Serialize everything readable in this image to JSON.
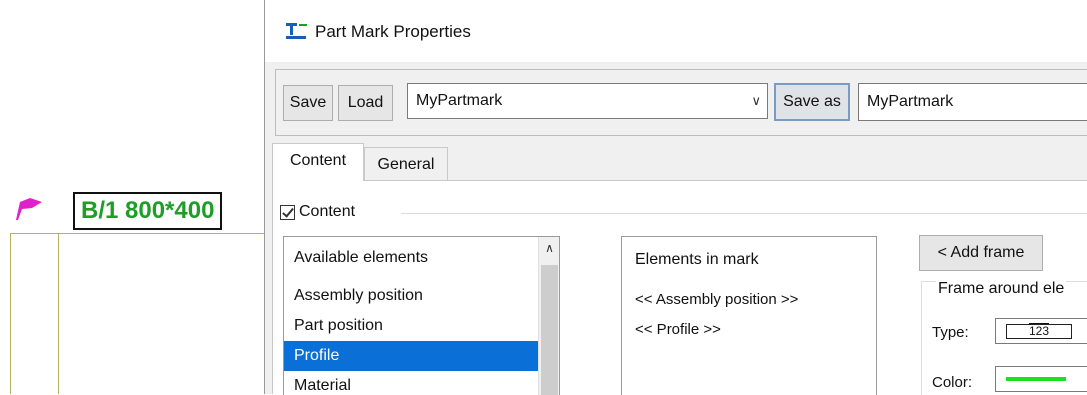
{
  "drawing": {
    "partmark_text": "B/1 800*400",
    "colors": {
      "partmark_text": "#1e9e27",
      "leader_flag": "#e020c8",
      "gridline": "#b3b15a"
    }
  },
  "dialog": {
    "title": "Part Mark Properties",
    "toolbar": {
      "save_label": "Save",
      "load_label": "Load",
      "settings_value": "MyPartmark",
      "save_as_label": "Save as",
      "save_as_value": "MyPartmark"
    },
    "tabs": [
      {
        "label": "Content",
        "active": true
      },
      {
        "label": "General",
        "active": false
      }
    ],
    "content_checkbox": {
      "label": "Content",
      "checked": true
    },
    "available_elements": {
      "header": "Available elements",
      "items": [
        "Assembly position",
        "Part position",
        "Profile",
        "Material"
      ],
      "selected": "Profile"
    },
    "elements_in_mark": {
      "header": "Elements in mark",
      "items": [
        "<< Assembly position >>",
        "<< Profile >>"
      ]
    },
    "add_frame_label": "< Add frame",
    "frame": {
      "legend": "Frame around ele",
      "type_label": "Type:",
      "type_value": "123",
      "color_label": "Color:",
      "color_value": "#1ee01e"
    },
    "accent_selection": "#0a6fd6"
  }
}
